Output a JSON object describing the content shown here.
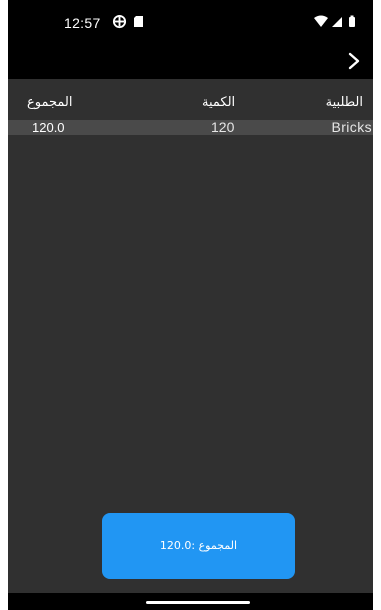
{
  "status_bar": {
    "time": "12:57",
    "icons": [
      "data-saver-icon",
      "sd-card-icon",
      "wifi-icon",
      "cell-signal-icon",
      "battery-icon"
    ]
  },
  "app_bar": {
    "forward_label": ">"
  },
  "table": {
    "headers": {
      "total": "المجموع",
      "quantity": "الكمية",
      "item": "الطلبية"
    },
    "rows": [
      {
        "total": "120.0",
        "quantity": "120",
        "item": "Bricks"
      }
    ]
  },
  "total_button": {
    "label": "المجموع :120.0"
  },
  "colors": {
    "background": "#303030",
    "row": "#4a4a4a",
    "accent": "#2196f3"
  }
}
